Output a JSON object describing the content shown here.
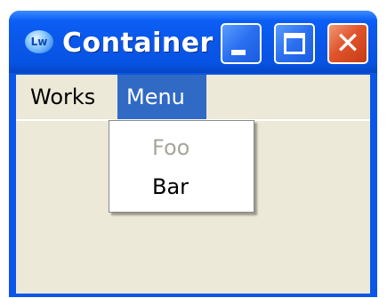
{
  "window": {
    "title": "Container",
    "icon_text": "Lw",
    "close_glyph": "✕"
  },
  "menubar": {
    "items": [
      {
        "label": "Works"
      },
      {
        "label": "Menu",
        "selected": true
      }
    ]
  },
  "dropdown": {
    "items": [
      {
        "label": "Foo",
        "disabled": true
      },
      {
        "label": "Bar",
        "disabled": false
      }
    ]
  },
  "colors": {
    "title_bar": "#0a57e9",
    "selection": "#316ac5",
    "client_bg": "#ece9d8",
    "close_button": "#e0542c",
    "disabled_text": "#a7a69c"
  }
}
